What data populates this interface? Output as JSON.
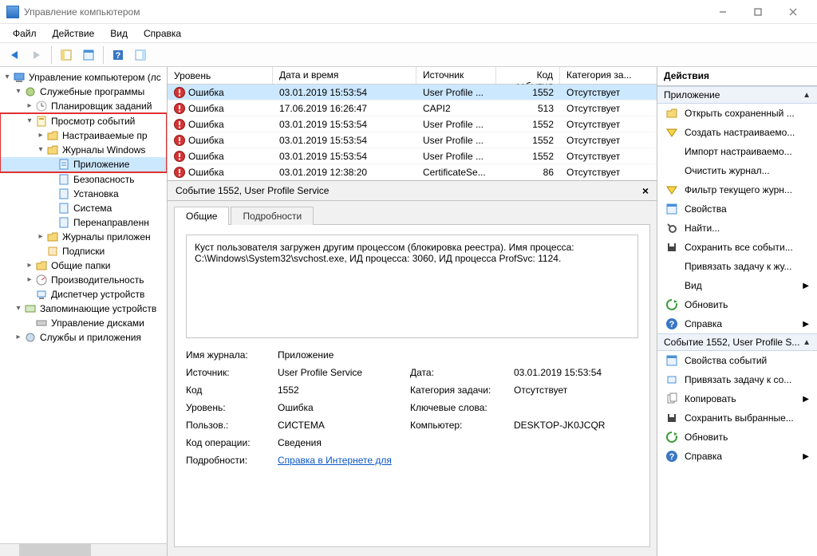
{
  "window": {
    "title": "Управление компьютером"
  },
  "menu": [
    "Файл",
    "Действие",
    "Вид",
    "Справка"
  ],
  "tree": {
    "root": "Управление компьютером (лс",
    "utils": "Служебные программы",
    "scheduler": "Планировщик заданий",
    "eventviewer": "Просмотр событий",
    "customviews": "Настраиваемые пр",
    "winlogs": "Журналы Windows",
    "app": "Приложение",
    "security": "Безопасность",
    "setup": "Установка",
    "system": "Система",
    "forwarded": "Перенаправленн",
    "applogs": "Журналы приложен",
    "subscriptions": "Подписки",
    "shared": "Общие папки",
    "perf": "Производительность",
    "devmgr": "Диспетчер устройств",
    "storage": "Запоминающие устройств",
    "diskmgmt": "Управление дисками",
    "services": "Службы и приложения"
  },
  "grid": {
    "cols": {
      "level": "Уровень",
      "date": "Дата и время",
      "src": "Источник",
      "id": "Код события",
      "cat": "Категория за..."
    },
    "rows": [
      {
        "level": "Ошибка",
        "date": "03.01.2019 15:53:54",
        "src": "User Profile ...",
        "id": "1552",
        "cat": "Отсутствует"
      },
      {
        "level": "Ошибка",
        "date": "17.06.2019 16:26:47",
        "src": "CAPI2",
        "id": "513",
        "cat": "Отсутствует"
      },
      {
        "level": "Ошибка",
        "date": "03.01.2019 15:53:54",
        "src": "User Profile ...",
        "id": "1552",
        "cat": "Отсутствует"
      },
      {
        "level": "Ошибка",
        "date": "03.01.2019 15:53:54",
        "src": "User Profile ...",
        "id": "1552",
        "cat": "Отсутствует"
      },
      {
        "level": "Ошибка",
        "date": "03.01.2019 15:53:54",
        "src": "User Profile ...",
        "id": "1552",
        "cat": "Отсутствует"
      },
      {
        "level": "Ошибка",
        "date": "03.01.2019 12:38:20",
        "src": "CertificateSe...",
        "id": "86",
        "cat": "Отсутствует"
      }
    ]
  },
  "detail": {
    "title": "Событие 1552, User Profile Service",
    "tabs": {
      "general": "Общие",
      "details": "Подробности"
    },
    "description": "Куст пользователя загружен другим процессом (блокировка реестра). Имя процесса: C:\\Windows\\System32\\svchost.exe, ИД процесса: 3060, ИД процесса ProfSvc: 1124.",
    "labels": {
      "logname": "Имя журнала:",
      "source": "Источник:",
      "eventid": "Код",
      "level": "Уровень:",
      "user": "Пользов.:",
      "opcode": "Код операции:",
      "moreinfo": "Подробности:",
      "date": "Дата:",
      "taskcat": "Категория задачи:",
      "keywords": "Ключевые слова:",
      "computer": "Компьютер:"
    },
    "values": {
      "logname": "Приложение",
      "source": "User Profile Service",
      "eventid": "1552",
      "level": "Ошибка",
      "user": "СИСТЕМА",
      "opcode": "Сведения",
      "date": "03.01.2019 15:53:54",
      "taskcat": "Отсутствует",
      "keywords": "",
      "computer": "DESKTOP-JK0JCQR",
      "moreinfo_link": "Справка в Интернете для"
    }
  },
  "actions": {
    "title": "Действия",
    "section1": "Приложение",
    "section2": "Событие 1552, User Profile S...",
    "items1": [
      "Открыть сохраненный ...",
      "Создать настраиваемо...",
      "Импорт настраиваемо...",
      "Очистить журнал...",
      "Фильтр текущего журн...",
      "Свойства",
      "Найти...",
      "Сохранить все событи...",
      "Привязать задачу к жу..."
    ],
    "view": "Вид",
    "refresh": "Обновить",
    "help": "Справка",
    "items2": [
      "Свойства событий",
      "Привязать задачу к со...",
      "Копировать",
      "Сохранить выбранные...",
      "Обновить",
      "Справка"
    ]
  }
}
